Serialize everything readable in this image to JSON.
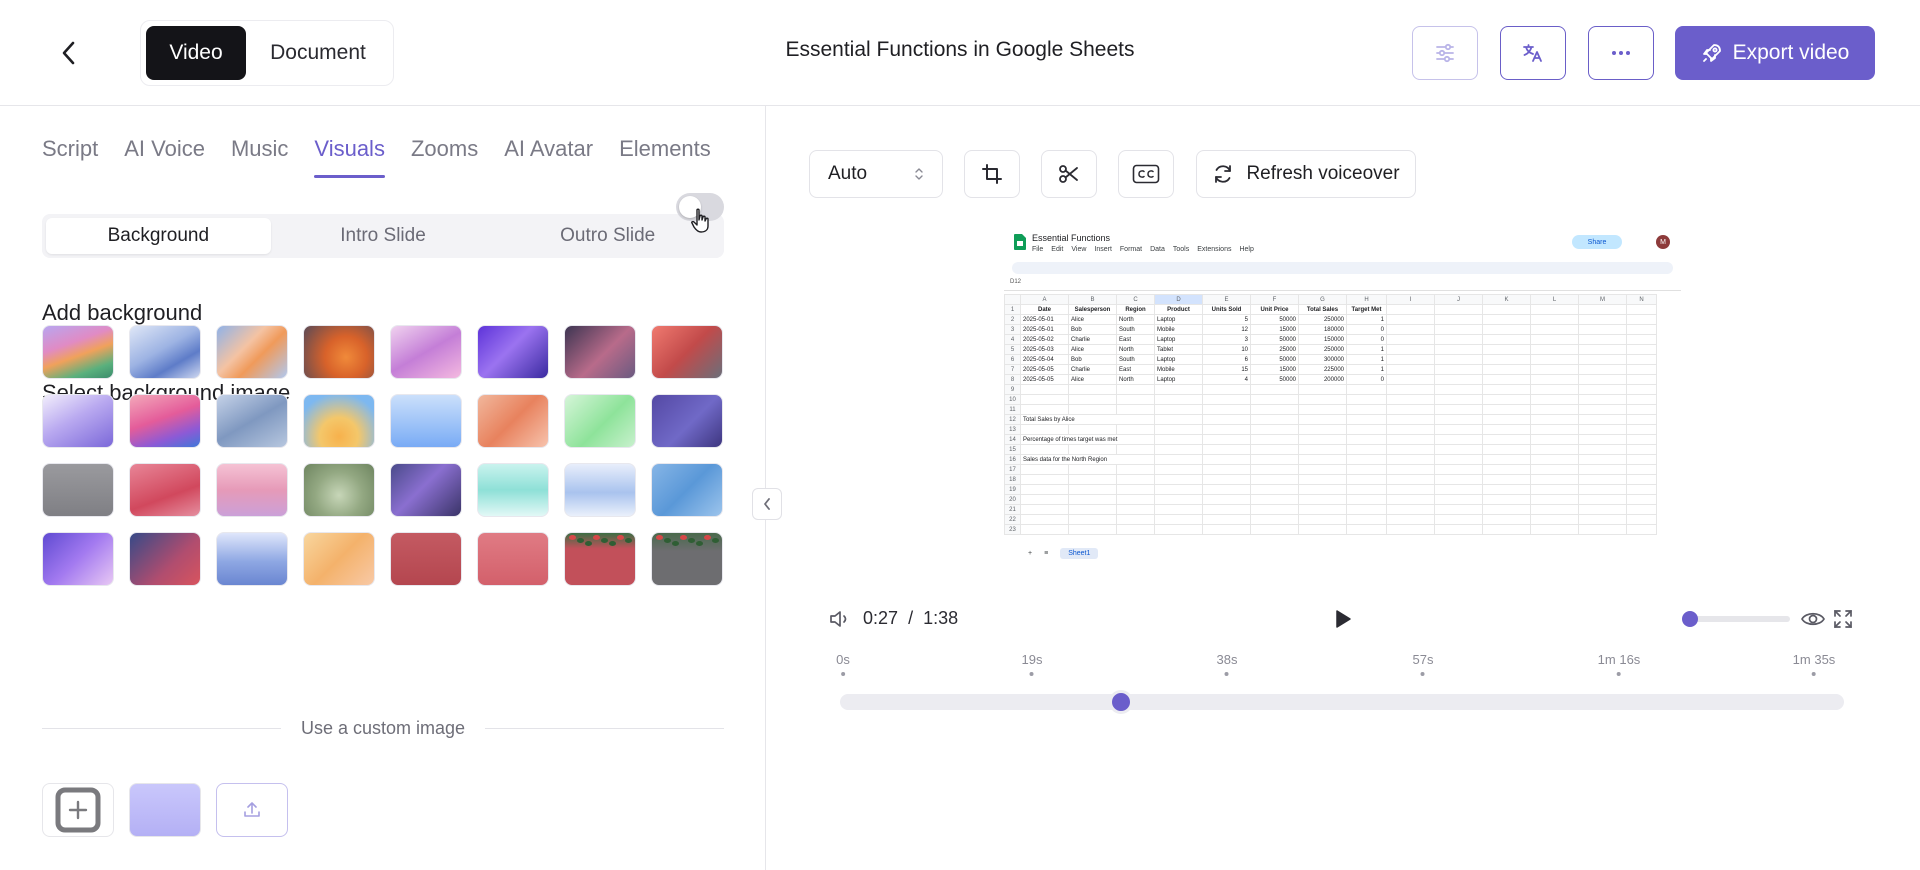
{
  "header": {
    "mode_video": "Video",
    "mode_document": "Document",
    "title": "Essential Functions in Google Sheets",
    "export_label": "Export video"
  },
  "tabs": [
    "Script",
    "AI Voice",
    "Music",
    "Visuals",
    "Zooms",
    "AI Avatar",
    "Elements"
  ],
  "active_tab": "Visuals",
  "segments": [
    "Background",
    "Intro Slide",
    "Outro Slide"
  ],
  "active_segment": "Background",
  "add_background_label": "Add background",
  "add_background_enabled": false,
  "select_bg_label": "Select background image",
  "custom_image_label": "Use a custom image",
  "toolbar": {
    "aspect_value": "Auto",
    "refresh_label": "Refresh voiceover"
  },
  "player": {
    "current_time": "0:27",
    "total_time": "1:38",
    "volume_fraction": 0.0,
    "progress_fraction": 0.28
  },
  "timeline_ticks": [
    "0s",
    "19s",
    "38s",
    "57s",
    "1m 16s",
    "1m 35s"
  ],
  "preview": {
    "doc_title": "Essential Functions",
    "menu": [
      "File",
      "Edit",
      "View",
      "Insert",
      "Format",
      "Data",
      "Tools",
      "Extensions",
      "Help"
    ],
    "share_label": "Share",
    "avatar_initial": "M",
    "cell_ref": "D12",
    "columns": [
      "A",
      "B",
      "C",
      "D",
      "E",
      "F",
      "G",
      "H",
      "I",
      "J",
      "K",
      "L",
      "M",
      "N"
    ],
    "headers": [
      "Date",
      "Salesperson",
      "Region",
      "Product",
      "Units Sold",
      "Unit Price",
      "Total Sales",
      "Target Met"
    ],
    "rows": [
      [
        "2025-05-01",
        "Alice",
        "North",
        "Laptop",
        "5",
        "50000",
        "250000",
        "1"
      ],
      [
        "2025-05-01",
        "Bob",
        "South",
        "Mobile",
        "12",
        "15000",
        "180000",
        "0"
      ],
      [
        "2025-05-02",
        "Charlie",
        "East",
        "Laptop",
        "3",
        "50000",
        "150000",
        "0"
      ],
      [
        "2025-05-03",
        "Alice",
        "North",
        "Tablet",
        "10",
        "25000",
        "250000",
        "1"
      ],
      [
        "2025-05-04",
        "Bob",
        "South",
        "Laptop",
        "6",
        "50000",
        "300000",
        "1"
      ],
      [
        "2025-05-05",
        "Charlie",
        "East",
        "Mobile",
        "15",
        "15000",
        "225000",
        "1"
      ],
      [
        "2025-05-05",
        "Alice",
        "North",
        "Laptop",
        "4",
        "50000",
        "200000",
        "0"
      ]
    ],
    "notes": [
      {
        "row": "12",
        "text": "Total Sales by Alice"
      },
      {
        "row": "14",
        "text": "Percentage of times target was met"
      },
      {
        "row": "16",
        "text": "Sales data for the North Region"
      }
    ],
    "sheet_tab": "Sheet1"
  },
  "backgrounds": [
    {
      "name": "bg-macos-sonoma",
      "bg": "linear-gradient(160deg,#b8a6f0 0%,#e08bc4 35%,#f0a15b 55%,#59b07d 80%,#3b8c6c 100%)"
    },
    {
      "name": "bg-blue-wave",
      "bg": "linear-gradient(150deg,#dfe7f7 0%,#9db3e3 45%,#5e7cc8 70%,#cfd8f0 100%)"
    },
    {
      "name": "bg-orange-light",
      "bg": "linear-gradient(135deg,#8fb2e8 0%,#f4c3a3 40%,#f09a5a 60%,#b0c8ef 100%)"
    },
    {
      "name": "bg-orange-dark",
      "bg": "radial-gradient(circle at 60% 60%,#f08a3a 0%,#d8622a 40%,#5a4a56 100%)"
    },
    {
      "name": "bg-lilac-pink",
      "bg": "linear-gradient(150deg,#f0d2ef 0%,#c47ed7 50%,#f4b9e0 100%)"
    },
    {
      "name": "bg-purple-glow",
      "bg": "linear-gradient(135deg,#5d33d9 0%,#9b73f0 45%,#3a2aa0 100%)"
    },
    {
      "name": "bg-dark-rose",
      "bg": "linear-gradient(135deg,#3d3552 0%,#b86b8a 55%,#6a5a80 100%)"
    },
    {
      "name": "bg-red-smoke",
      "bg": "linear-gradient(135deg,#f07a70 0%,#c24a4a 50%,#6b6f7a 100%)"
    },
    {
      "name": "bg-lavender",
      "bg": "linear-gradient(150deg,#f2eefc 0%,#b9a9f0 45%,#7b68d9 100%)"
    },
    {
      "name": "bg-pink-sunset",
      "bg": "linear-gradient(160deg,#f3a9ba 0%,#e45c9a 45%,#8c5ad6 75%,#3f78d8 100%)"
    },
    {
      "name": "bg-steel-blue",
      "bg": "linear-gradient(150deg,#c5d2e8 0%,#7f98c0 50%,#b7c7df 100%)"
    },
    {
      "name": "bg-sunrise",
      "bg": "radial-gradient(circle at 50% 80%,#f7b14c 0%,#f4c76a 35%,#7db8f0 80%)"
    },
    {
      "name": "bg-sky",
      "bg": "linear-gradient(180deg,#cbe0fb 0%,#79abf5 100%)"
    },
    {
      "name": "bg-peach",
      "bg": "linear-gradient(135deg,#f1b79c 0%,#e8825e 50%,#f7c3ad 100%)"
    },
    {
      "name": "bg-mint",
      "bg": "linear-gradient(135deg,#d5f5d8 0%,#8ee39a 55%,#c8f1cd 100%)"
    },
    {
      "name": "bg-indigo",
      "bg": "linear-gradient(135deg,#5448a4 0%,#7069c7 55%,#3e3680 100%)"
    },
    {
      "name": "bg-gray",
      "bg": "linear-gradient(180deg,#9a9a9e 0%,#7f7f84 100%)"
    },
    {
      "name": "bg-coral",
      "bg": "linear-gradient(160deg,#e88597 0%,#d1485d 60%,#e58fa0 100%)"
    },
    {
      "name": "bg-pink-haze",
      "bg": "linear-gradient(180deg,#f5c2d4 0%,#e69ab8 50%,#cba0d8 100%)"
    },
    {
      "name": "bg-olive",
      "bg": "radial-gradient(circle at 50% 60%,#c7d6b8 0%,#93a882 50%,#6e8560 100%)"
    },
    {
      "name": "bg-violet-leaf",
      "bg": "linear-gradient(135deg,#4a4a8a 0%,#8a6fd0 45%,#3a3468 100%)"
    },
    {
      "name": "bg-aqua",
      "bg": "linear-gradient(180deg,#c9f3ee 0%,#8ee0d7 50%,#e2f8f6 100%)"
    },
    {
      "name": "bg-cloud-blue",
      "bg": "linear-gradient(180deg,#e8eefb 0%,#a9c3ee 55%,#eaf0fb 100%)"
    },
    {
      "name": "bg-ocean",
      "bg": "linear-gradient(135deg,#86b5e6 0%,#5a98d8 50%,#9cc4ec 100%)"
    },
    {
      "name": "bg-purple-blur",
      "bg": "linear-gradient(135deg,#5f4ad2 0%,#a37af0 50%,#e8c8f4 100%)"
    },
    {
      "name": "bg-dusk",
      "bg": "linear-gradient(135deg,#364a88 0%,#b04d6f 60%,#d8545e 100%)"
    },
    {
      "name": "bg-periwinkle",
      "bg": "linear-gradient(180deg,#dfe6fb 0%,#8ea7e3 55%,#6a86d1 100%)"
    },
    {
      "name": "bg-apricot",
      "bg": "linear-gradient(135deg,#f8d69e 0%,#f4b26b 50%,#f8c9a6 100%)"
    },
    {
      "name": "bg-rose-brick",
      "bg": "linear-gradient(180deg,#c45a62 0%,#b4464f 100%)"
    },
    {
      "name": "bg-salmon",
      "bg": "linear-gradient(180deg,#e07b84 0%,#d3606b 100%)"
    },
    {
      "name": "bg-holly-red",
      "bg": "linear-gradient(180deg,#3c6e44 0%,#c2505a 30%,#c2505a 100%)"
    },
    {
      "name": "bg-holly-gray",
      "bg": "linear-gradient(180deg,#4a6a4c 0%,#6d6d70 35%,#6d6d70 100%)"
    }
  ],
  "colors": {
    "accent": "#6b5ecb",
    "text": "#1f1f23",
    "muted": "#7a7a86"
  }
}
